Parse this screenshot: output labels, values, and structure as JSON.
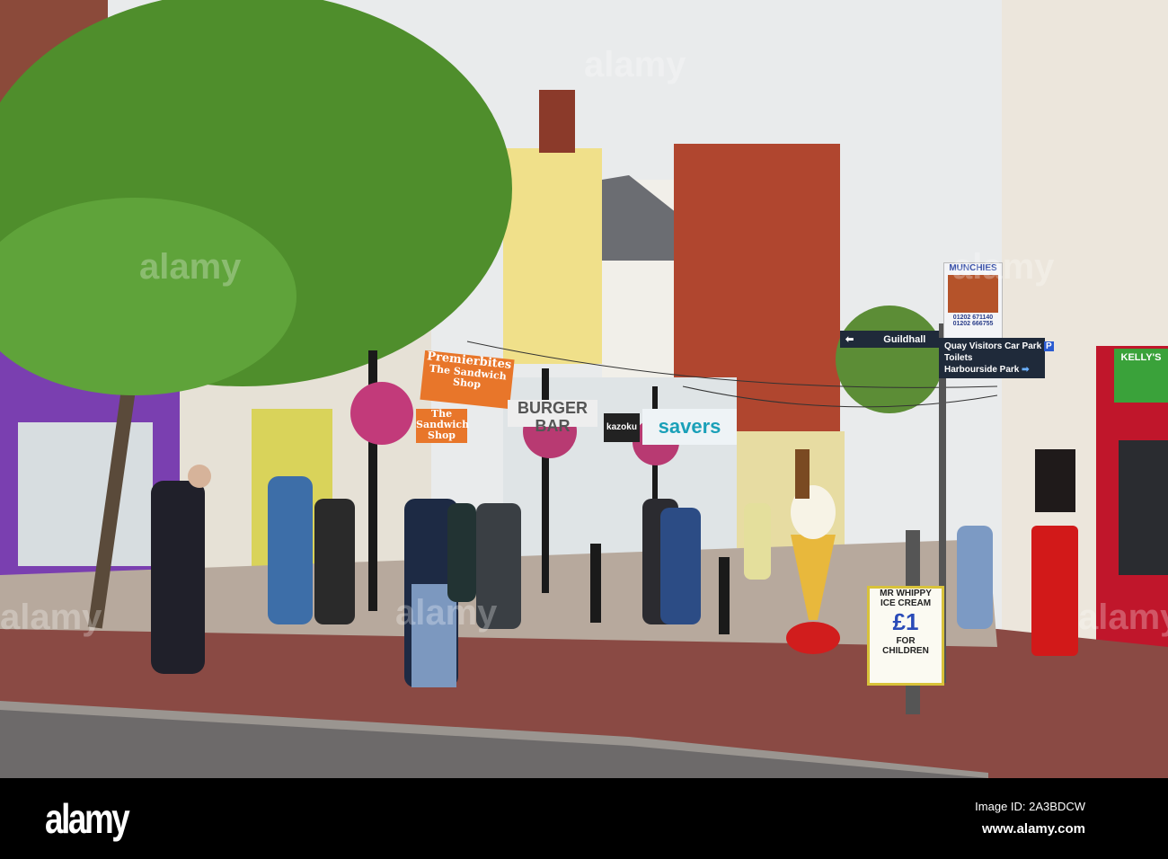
{
  "scene": {
    "shop_signs": {
      "premierbites": "Premierbites",
      "premierbites_sub": "The Sandwich Shop",
      "sandwich_shop": "The Sandwich Shop",
      "burger": "BURGER BAR",
      "kazoku": "kazoku",
      "savers": "savers",
      "kellys": "KELLY'S"
    },
    "munchies": {
      "name": "MUNCHIES",
      "phone1": "01202 671140",
      "phone2": "01202 666755"
    },
    "signposts": {
      "guildhall": "Guildhall",
      "quay": "Quay Visitors Car Park",
      "parking": "P",
      "toilets": "Toilets",
      "harbourside": "Harbourside Park"
    },
    "aboard": {
      "line1": "MR WHIPPY",
      "line2": "ICE CREAM",
      "price": "£1",
      "line3": "FOR",
      "line4": "CHILDREN"
    },
    "colors": {
      "sky": "#e9ebec",
      "pavement": "#8a4a44",
      "road": "#6d6a6a",
      "tree": "#4f8e2c"
    }
  },
  "watermarks": [
    "alamy",
    "alamy",
    "alamy",
    "alamy",
    "alamy",
    "alamy"
  ],
  "footer": {
    "logo": "alamy",
    "image_id": "Image ID: 2A3BDCW",
    "url": "www.alamy.com"
  }
}
